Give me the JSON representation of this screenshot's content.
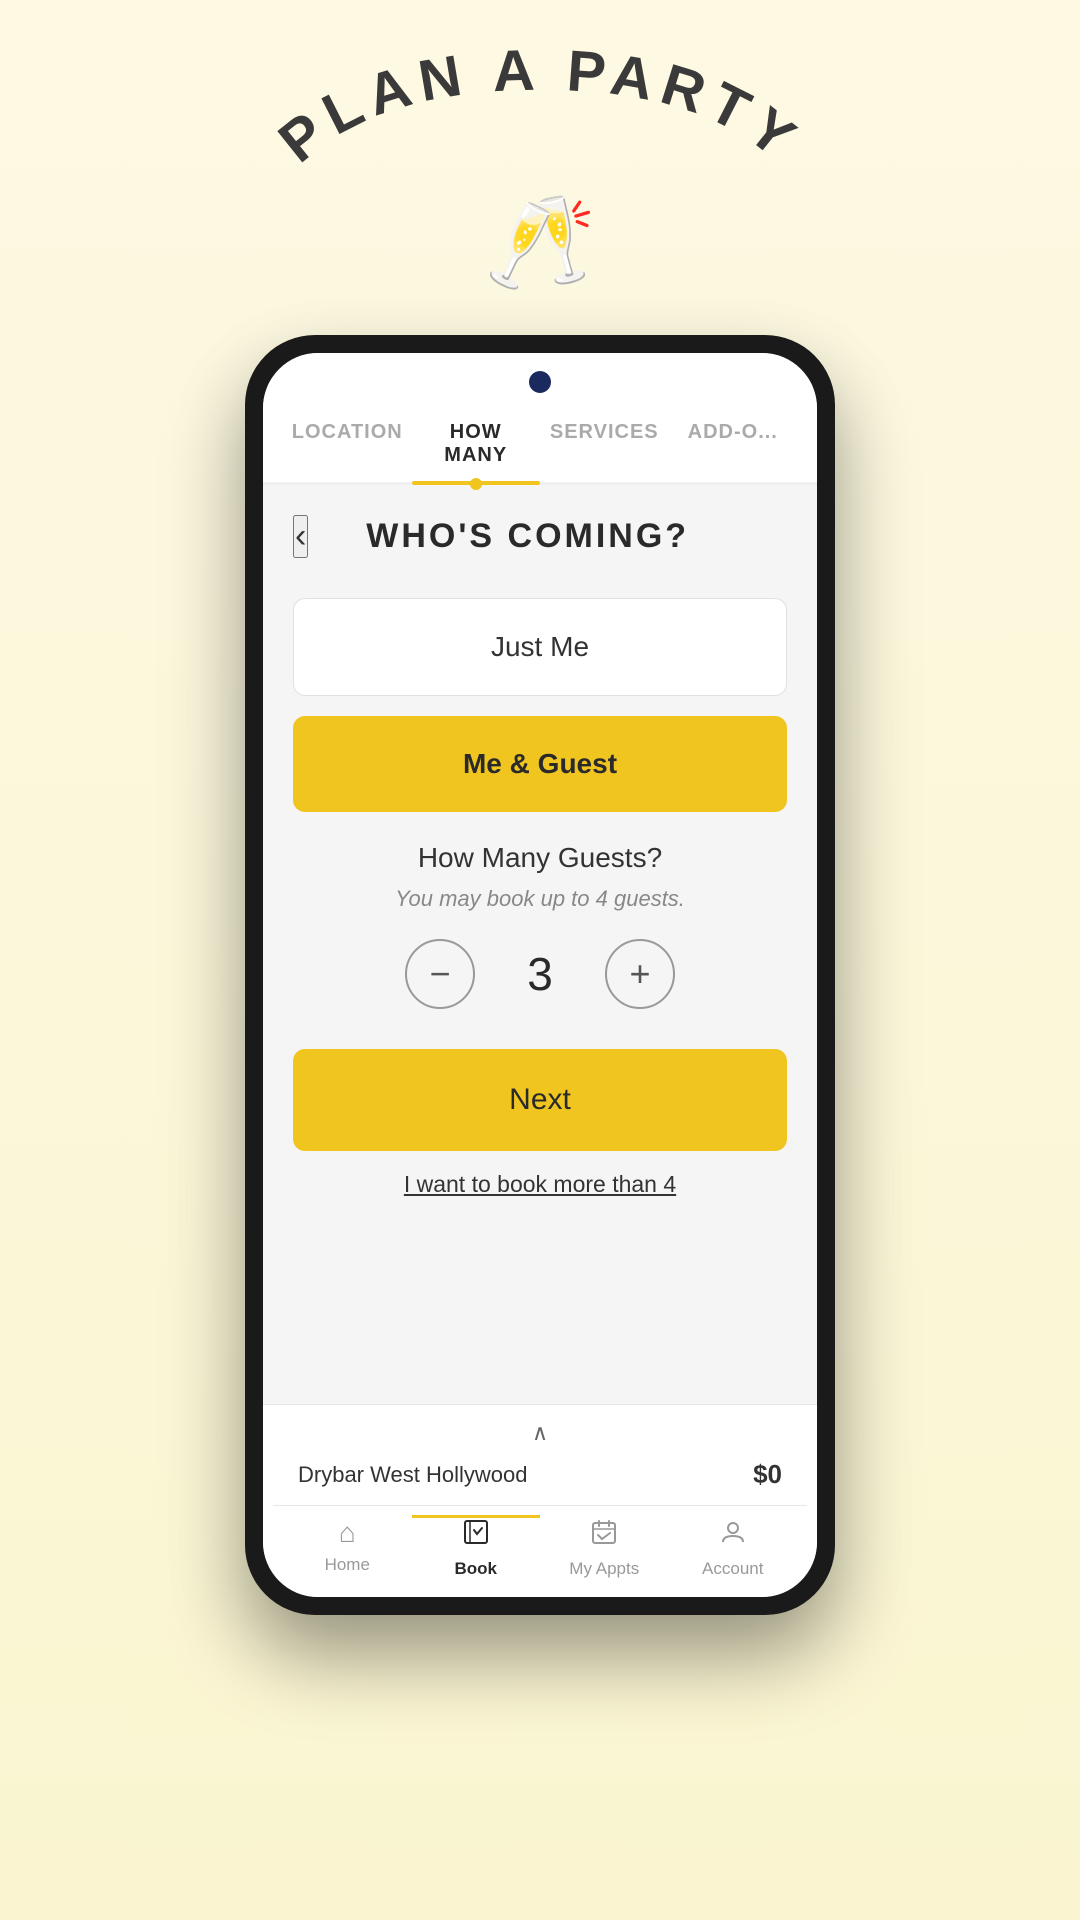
{
  "header": {
    "title": "PLAN A PARTY",
    "champagne_icon": "🥂"
  },
  "tabs": [
    {
      "id": "location",
      "label": "LOCATION",
      "active": false
    },
    {
      "id": "how-many",
      "label": "HOW MANY",
      "active": true
    },
    {
      "id": "services",
      "label": "SERVICES",
      "active": false
    },
    {
      "id": "add-ons",
      "label": "ADD-O...",
      "active": false
    }
  ],
  "page": {
    "title": "WHO'S COMING?"
  },
  "options": {
    "just_me": "Just Me",
    "me_and_guest": "Me & Guest"
  },
  "guest_counter": {
    "title": "How Many Guests?",
    "subtitle": "You may book up to 4 guests.",
    "value": "3",
    "minus_label": "−",
    "plus_label": "+"
  },
  "next_button": {
    "label": "Next"
  },
  "book_more_link": "I want to book more than 4",
  "bottom_bar": {
    "location": "Drybar West Hollywood",
    "price": "$0"
  },
  "bottom_nav": [
    {
      "id": "home",
      "label": "Home",
      "icon": "⌂",
      "active": false
    },
    {
      "id": "book",
      "label": "Book",
      "icon": "📋",
      "active": true
    },
    {
      "id": "my-appts",
      "label": "My Appts",
      "icon": "📅",
      "active": false
    },
    {
      "id": "account",
      "label": "Account",
      "icon": "👤",
      "active": false
    }
  ],
  "colors": {
    "yellow": "#f0c520",
    "dark": "#2a2a2a",
    "light_bg": "#f5f5f5"
  }
}
